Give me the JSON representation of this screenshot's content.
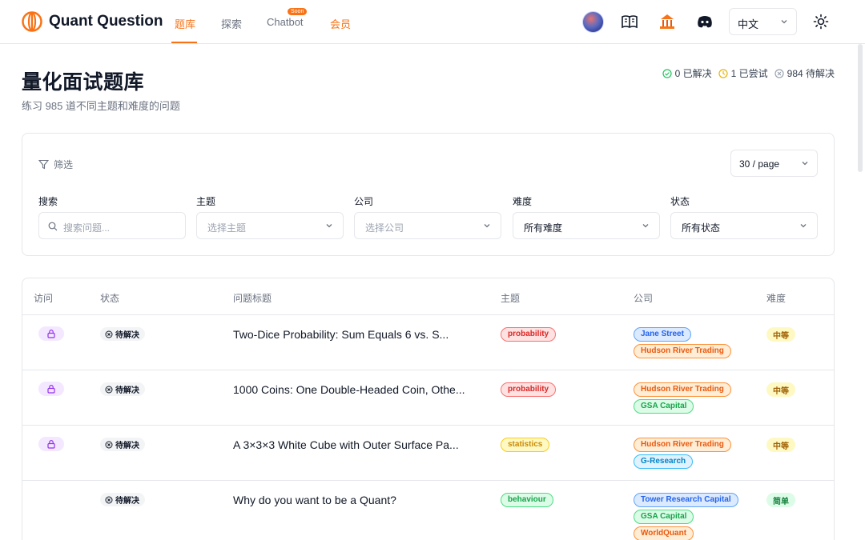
{
  "header": {
    "brand": "Quant Question",
    "nav": [
      "题库",
      "探索",
      "Chatbot",
      "会员"
    ],
    "soon_badge": "Soon",
    "language": "中文",
    "icons": [
      "avatar",
      "book-icon",
      "temple-icon",
      "discord-icon",
      "sun-icon"
    ]
  },
  "page": {
    "title": "量化面试题库",
    "subtitle": "练习 985 道不同主题和难度的问题",
    "stats": {
      "solved": "0 已解决",
      "attempted": "1 已尝试",
      "pending": "984 待解决"
    }
  },
  "filters": {
    "label": "筛选",
    "page_size": "30 / page",
    "search_label": "搜索",
    "search_placeholder": "搜索问题...",
    "topic_label": "主题",
    "topic_placeholder": "选择主题",
    "company_label": "公司",
    "company_placeholder": "选择公司",
    "difficulty_label": "难度",
    "difficulty_value": "所有难度",
    "status_label": "状态",
    "status_value": "所有状态"
  },
  "table": {
    "headers": [
      "访问",
      "状态",
      "问题标题",
      "主题",
      "公司",
      "难度"
    ],
    "rows": [
      {
        "locked": true,
        "status": "待解决",
        "title": "Two-Dice Probability: Sum Equals 6 vs. S...",
        "topic": "probability",
        "companies": [
          "Jane Street",
          "Hudson River Trading"
        ],
        "difficulty": "中等"
      },
      {
        "locked": true,
        "status": "待解决",
        "title": "1000 Coins: One Double-Headed Coin, Othe...",
        "topic": "probability",
        "companies": [
          "Hudson River Trading",
          "GSA Capital"
        ],
        "difficulty": "中等"
      },
      {
        "locked": true,
        "status": "待解决",
        "title": "A 3×3×3 White Cube with Outer Surface Pa...",
        "topic": "statistics",
        "companies": [
          "Hudson River Trading",
          "G-Research"
        ],
        "difficulty": "中等"
      },
      {
        "locked": false,
        "status": "待解决",
        "title": "Why do you want to be a Quant?",
        "topic": "behaviour",
        "companies": [
          "Tower Research Capital",
          "GSA Capital",
          "WorldQuant"
        ],
        "difficulty": "简单"
      }
    ]
  },
  "colors": {
    "accent": "#f97316"
  }
}
